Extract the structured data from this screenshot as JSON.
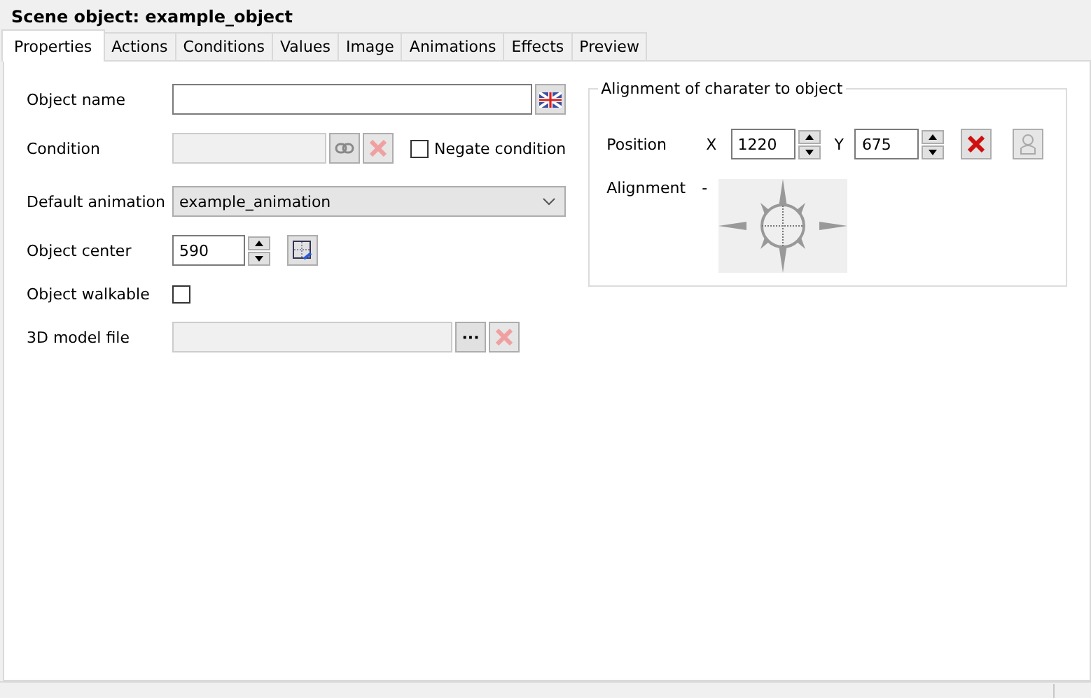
{
  "window": {
    "title": "Scene object: example_object"
  },
  "tabs": [
    {
      "label": "Properties",
      "selected": true
    },
    {
      "label": "Actions",
      "selected": false
    },
    {
      "label": "Conditions",
      "selected": false
    },
    {
      "label": "Values",
      "selected": false
    },
    {
      "label": "Image",
      "selected": false
    },
    {
      "label": "Animations",
      "selected": false
    },
    {
      "label": "Effects",
      "selected": false
    },
    {
      "label": "Preview",
      "selected": false
    }
  ],
  "form": {
    "object_name": {
      "label": "Object name"
    },
    "condition": {
      "label": "Condition",
      "disabled": true,
      "negate": {
        "label": "Negate condition",
        "checked": false
      }
    },
    "default_animation": {
      "label": "Default animation",
      "value": "example_animation"
    },
    "object_center": {
      "label": "Object center",
      "value": "590"
    },
    "object_walkable": {
      "label": "Object walkable",
      "checked": false
    },
    "model_file": {
      "label": "3D model file",
      "disabled": true,
      "browse": "···"
    }
  },
  "alignment_group": {
    "title": "Alignment of charater to object",
    "position_label": "Position",
    "x_label": "X",
    "x_value": "1220",
    "y_label": "Y",
    "y_value": "675",
    "alignment_label": "Alignment",
    "alignment_value": "-"
  }
}
